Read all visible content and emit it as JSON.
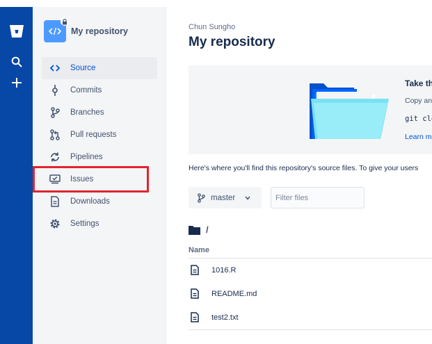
{
  "global_nav": {
    "logo_icon": "bitbucket-logo-icon",
    "search_icon": "search-icon",
    "create_icon": "plus-icon"
  },
  "sidebar": {
    "repo_name": "My repository",
    "items": [
      {
        "label": "Source",
        "icon": "code-icon",
        "active": true
      },
      {
        "label": "Commits",
        "icon": "commit-icon",
        "active": false
      },
      {
        "label": "Branches",
        "icon": "branch-icon",
        "active": false
      },
      {
        "label": "Pull requests",
        "icon": "pull-request-icon",
        "active": false
      },
      {
        "label": "Pipelines",
        "icon": "pipelines-icon",
        "active": false
      },
      {
        "label": "Issues",
        "icon": "issues-icon",
        "active": false
      },
      {
        "label": "Downloads",
        "icon": "downloads-icon",
        "active": false
      },
      {
        "label": "Settings",
        "icon": "settings-gear-icon",
        "active": false
      }
    ]
  },
  "main": {
    "breadcrumb": "Chun Sungho",
    "title": "My repository",
    "onboarding": {
      "title": "Take th",
      "description": "Copy an",
      "code": "git clo",
      "link": "Learn m"
    },
    "description": "Here's where you'll find this repository's source files. To give your users",
    "branch_label": "master",
    "filter_placeholder": "Filter files",
    "path": "/",
    "column_name": "Name",
    "files": [
      "1016.R",
      "README.md",
      "test2.txt"
    ]
  },
  "colors": {
    "global_nav_bg": "#0747a6",
    "sidebar_bg": "#f4f5f7",
    "accent": "#0052cc",
    "highlight_box": "#e3242b"
  }
}
